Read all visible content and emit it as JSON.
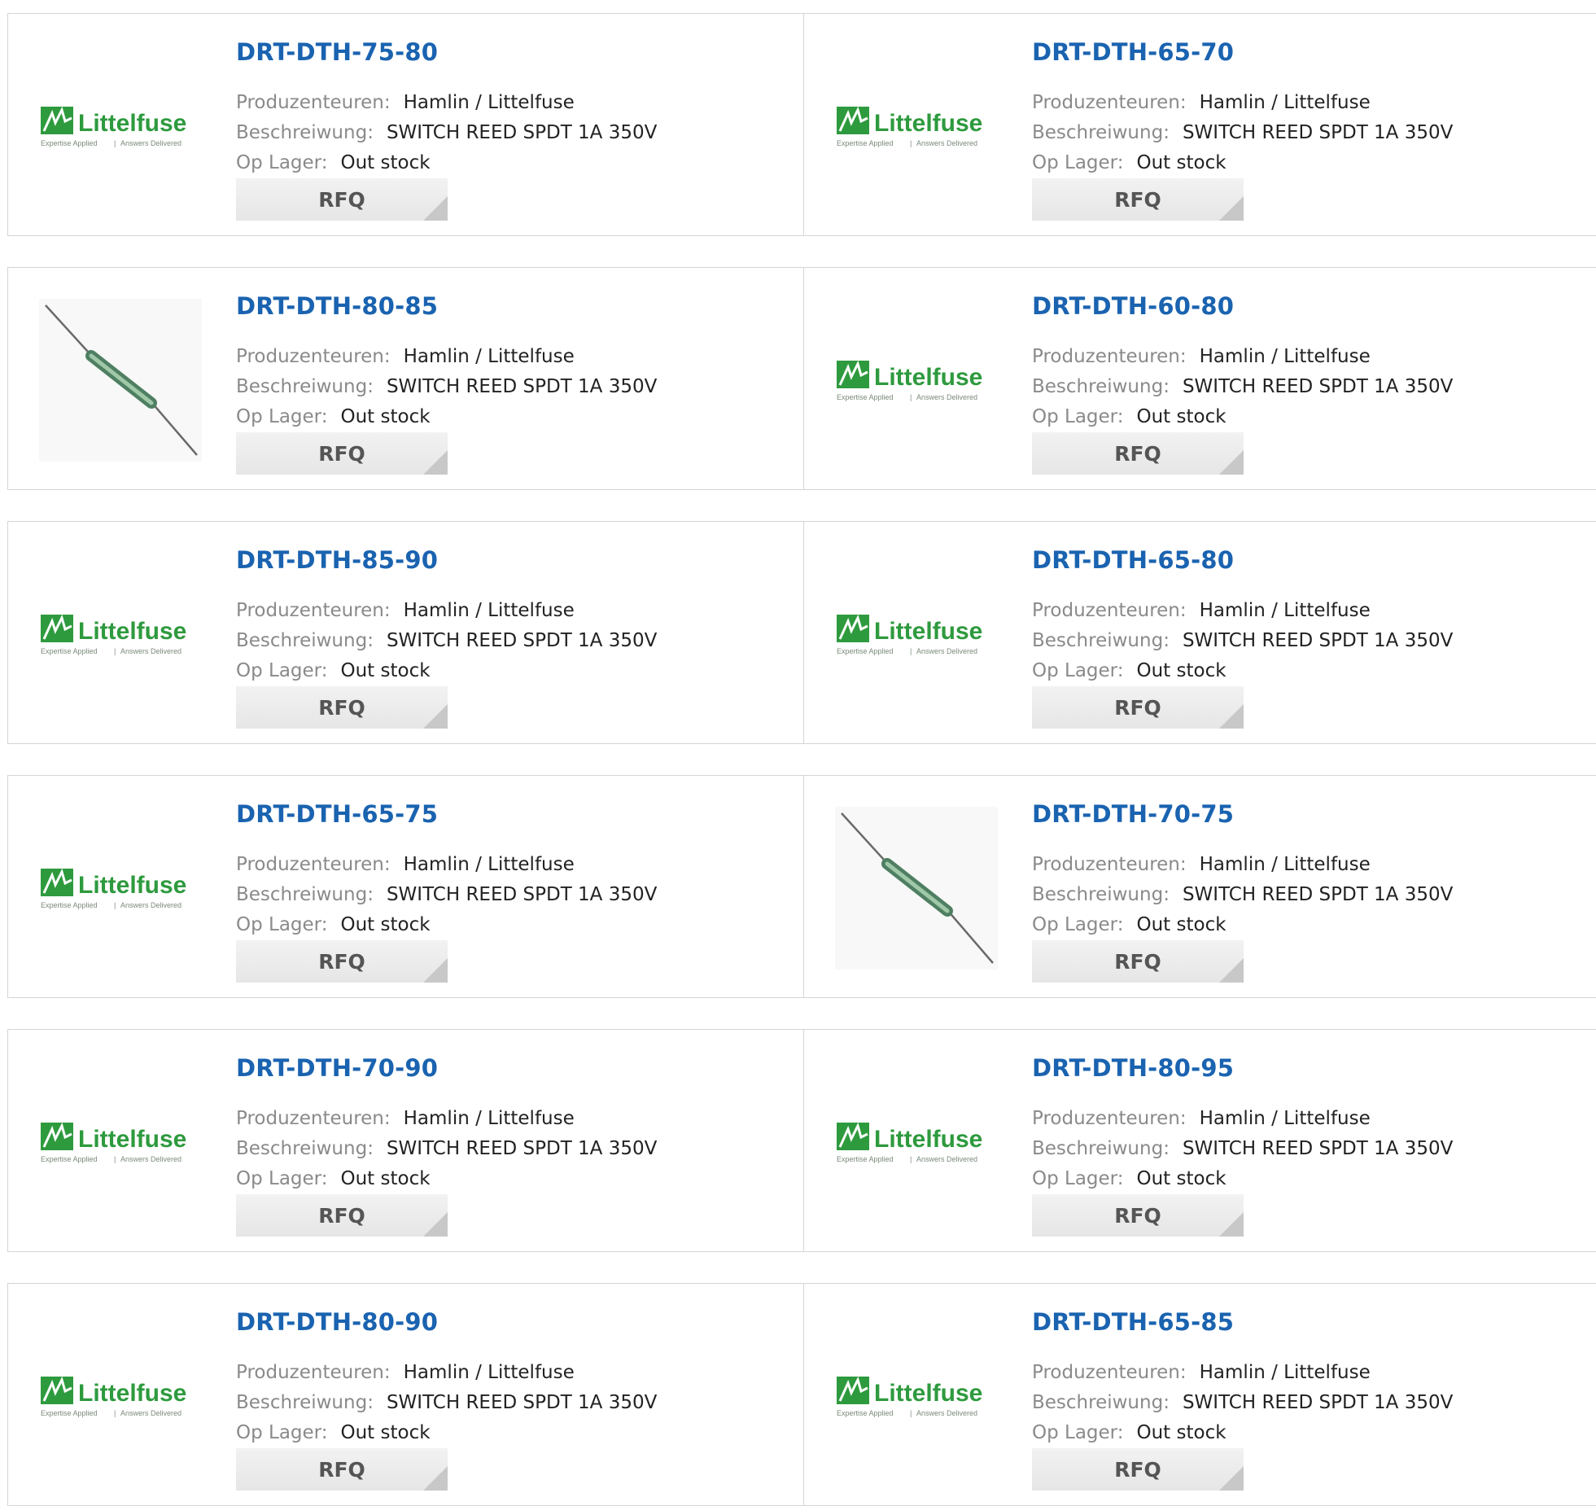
{
  "labels": {
    "manufacturer": "Produzenteuren:",
    "description": "Beschreiwung:",
    "stock": "Op Lager:",
    "rfq": "RFQ"
  },
  "logo": {
    "brand": "Littelfuse",
    "tagline_left": "Expertise Applied",
    "tagline_right": "Answers Delivered",
    "brand_color": "#2e9a3e"
  },
  "colors": {
    "part_link": "#1a63b0",
    "label": "#8a8a8a",
    "value": "#222222",
    "border": "#d5d5d5",
    "button_bg": "#ececec"
  },
  "products": [
    {
      "part": "DRT-DTH-75-80",
      "manufacturer": "Hamlin / Littelfuse",
      "description": "SWITCH REED SPDT 1A 350V",
      "stock": "Out stock",
      "image": "littelfuse-logo"
    },
    {
      "part": "DRT-DTH-65-70",
      "manufacturer": "Hamlin / Littelfuse",
      "description": "SWITCH REED SPDT 1A 350V",
      "stock": "Out stock",
      "image": "littelfuse-logo"
    },
    {
      "part": "DRT-DTH-80-85",
      "manufacturer": "Hamlin / Littelfuse",
      "description": "SWITCH REED SPDT 1A 350V",
      "stock": "Out stock",
      "image": "reed-switch-photo"
    },
    {
      "part": "DRT-DTH-60-80",
      "manufacturer": "Hamlin / Littelfuse",
      "description": "SWITCH REED SPDT 1A 350V",
      "stock": "Out stock",
      "image": "littelfuse-logo"
    },
    {
      "part": "DRT-DTH-85-90",
      "manufacturer": "Hamlin / Littelfuse",
      "description": "SWITCH REED SPDT 1A 350V",
      "stock": "Out stock",
      "image": "littelfuse-logo"
    },
    {
      "part": "DRT-DTH-65-80",
      "manufacturer": "Hamlin / Littelfuse",
      "description": "SWITCH REED SPDT 1A 350V",
      "stock": "Out stock",
      "image": "littelfuse-logo"
    },
    {
      "part": "DRT-DTH-65-75",
      "manufacturer": "Hamlin / Littelfuse",
      "description": "SWITCH REED SPDT 1A 350V",
      "stock": "Out stock",
      "image": "littelfuse-logo"
    },
    {
      "part": "DRT-DTH-70-75",
      "manufacturer": "Hamlin / Littelfuse",
      "description": "SWITCH REED SPDT 1A 350V",
      "stock": "Out stock",
      "image": "reed-switch-photo"
    },
    {
      "part": "DRT-DTH-70-90",
      "manufacturer": "Hamlin / Littelfuse",
      "description": "SWITCH REED SPDT 1A 350V",
      "stock": "Out stock",
      "image": "littelfuse-logo"
    },
    {
      "part": "DRT-DTH-80-95",
      "manufacturer": "Hamlin / Littelfuse",
      "description": "SWITCH REED SPDT 1A 350V",
      "stock": "Out stock",
      "image": "littelfuse-logo"
    },
    {
      "part": "DRT-DTH-80-90",
      "manufacturer": "Hamlin / Littelfuse",
      "description": "SWITCH REED SPDT 1A 350V",
      "stock": "Out stock",
      "image": "littelfuse-logo"
    },
    {
      "part": "DRT-DTH-65-85",
      "manufacturer": "Hamlin / Littelfuse",
      "description": "SWITCH REED SPDT 1A 350V",
      "stock": "Out stock",
      "image": "littelfuse-logo"
    }
  ]
}
